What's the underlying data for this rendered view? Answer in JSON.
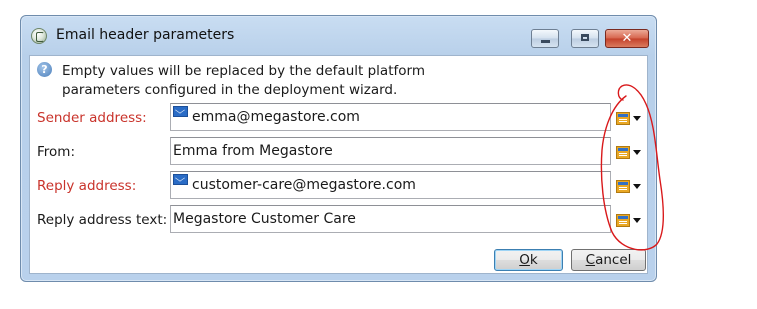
{
  "window": {
    "title": "Email header parameters",
    "controls": {
      "minimize": "minimize",
      "maximize": "maximize",
      "close": "✕"
    }
  },
  "info": {
    "text_line1": "Empty values will be replaced by the default platform",
    "text_line2": "parameters configured in the deployment wizard."
  },
  "fields": [
    {
      "label": "Sender address:",
      "value": "emma@megastore.com",
      "required": true,
      "icon": "mail-icon"
    },
    {
      "label": "From:",
      "value": "Emma from Megastore",
      "required": false,
      "icon": null
    },
    {
      "label": "Reply address:",
      "value": "customer-care@megastore.com",
      "required": true,
      "icon": "mail-icon"
    },
    {
      "label": "Reply address text:",
      "value": "Megastore Customer Care",
      "required": false,
      "icon": null
    }
  ],
  "buttons": {
    "ok": {
      "mnemonic": "O",
      "rest": "k"
    },
    "cancel": {
      "mnemonic": "C",
      "rest": "ancel"
    }
  },
  "colors": {
    "required_label": "#c9332b",
    "annotation": "#d9191b"
  }
}
